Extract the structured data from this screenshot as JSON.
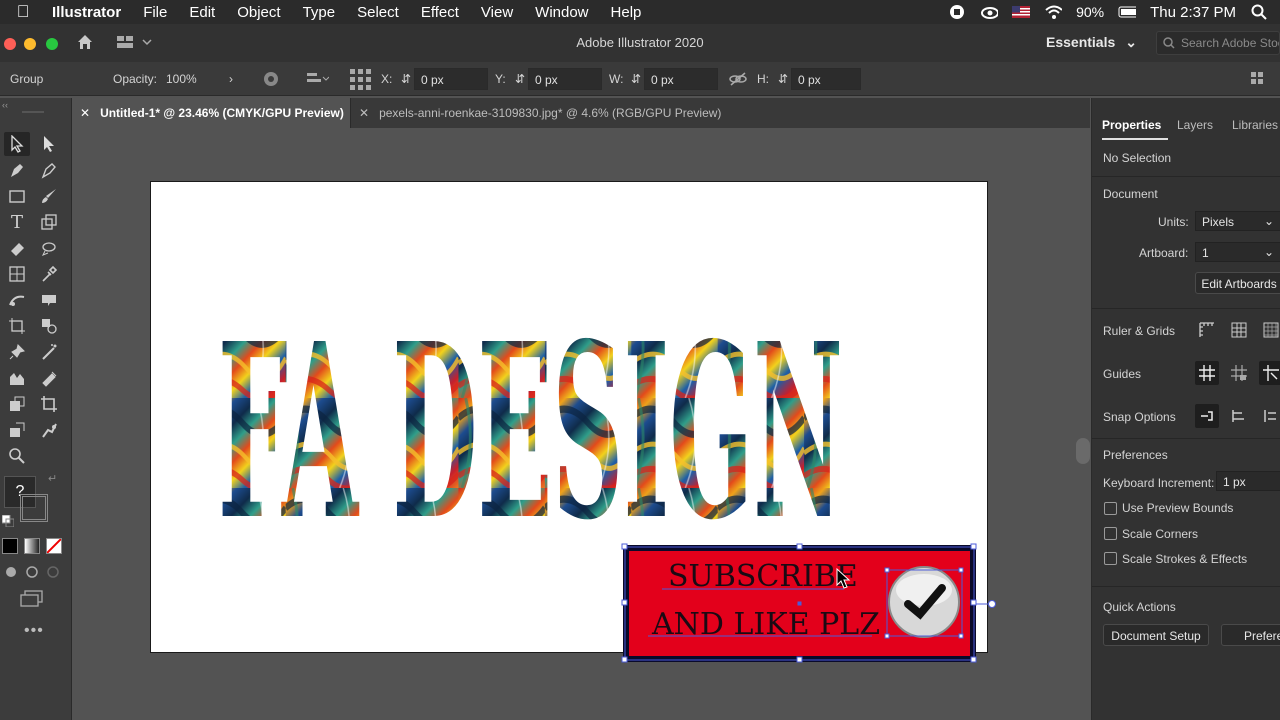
{
  "menubar": {
    "app": "Illustrator",
    "items": [
      "File",
      "Edit",
      "Object",
      "Type",
      "Select",
      "Effect",
      "View",
      "Window",
      "Help"
    ],
    "battery": "90%",
    "clock": "Thu 2:37 PM"
  },
  "window": {
    "title": "Adobe Illustrator 2020",
    "workspace": "Essentials",
    "search_placeholder": "Search Adobe Stock"
  },
  "control_bar": {
    "selection": "Group",
    "opacity_label": "Opacity:",
    "opacity_value": "100%",
    "x_label": "X:",
    "x_value": "0 px",
    "y_label": "Y:",
    "y_value": "0 px",
    "w_label": "W:",
    "w_value": "0 px",
    "h_label": "H:",
    "h_value": "0 px"
  },
  "tabs": [
    {
      "label": "Untitled-1* @ 23.46% (CMYK/GPU Preview)",
      "active": true
    },
    {
      "label": "pexels-anni-roenkae-3109830.jpg* @ 4.6% (RGB/GPU Preview)",
      "active": false
    }
  ],
  "artwork": {
    "headline": "FA DESIGN",
    "button_line1": "SUBSCRIBE",
    "button_line2": "AND LIKE PLZ"
  },
  "properties": {
    "tabs": [
      "Properties",
      "Layers",
      "Libraries"
    ],
    "no_selection": "No Selection",
    "document_label": "Document",
    "units_label": "Units:",
    "units_value": "Pixels",
    "artboard_label": "Artboard:",
    "artboard_value": "1",
    "edit_artboards": "Edit Artboards",
    "ruler_grids": "Ruler & Grids",
    "guides": "Guides",
    "snap_options": "Snap Options",
    "preferences": "Preferences",
    "keyboard_increment_label": "Keyboard Increment:",
    "keyboard_increment_value": "1 px",
    "checkboxes": [
      "Use Preview Bounds",
      "Scale Corners",
      "Scale Strokes & Effects"
    ],
    "quick_actions": "Quick Actions",
    "document_setup": "Document Setup",
    "preferences_btn": "Preferences"
  },
  "colors": {
    "red_button": "#e3001b",
    "selection": "#4b5bd8"
  }
}
